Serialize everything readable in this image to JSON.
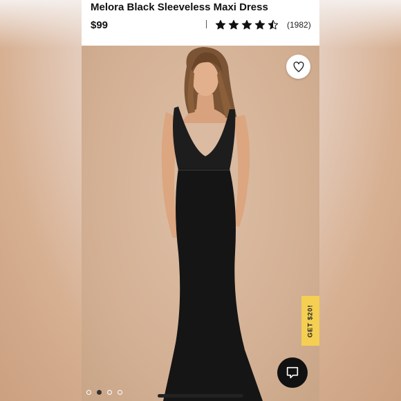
{
  "product": {
    "title": "Melora Black Sleeveless Maxi Dress",
    "price": "$99",
    "rating": 4.5,
    "rating_max": 5,
    "review_count": "(1982)"
  },
  "wishlist": {
    "icon": "heart-outline-icon"
  },
  "promo": {
    "label": "GET $20!"
  },
  "chat": {
    "icon": "chat-bubble-icon"
  },
  "carousel": {
    "slides": 4,
    "active_index": 1
  },
  "colors": {
    "promo": "#f4cf52",
    "chat": "#111111",
    "accent_text": "#111111"
  }
}
